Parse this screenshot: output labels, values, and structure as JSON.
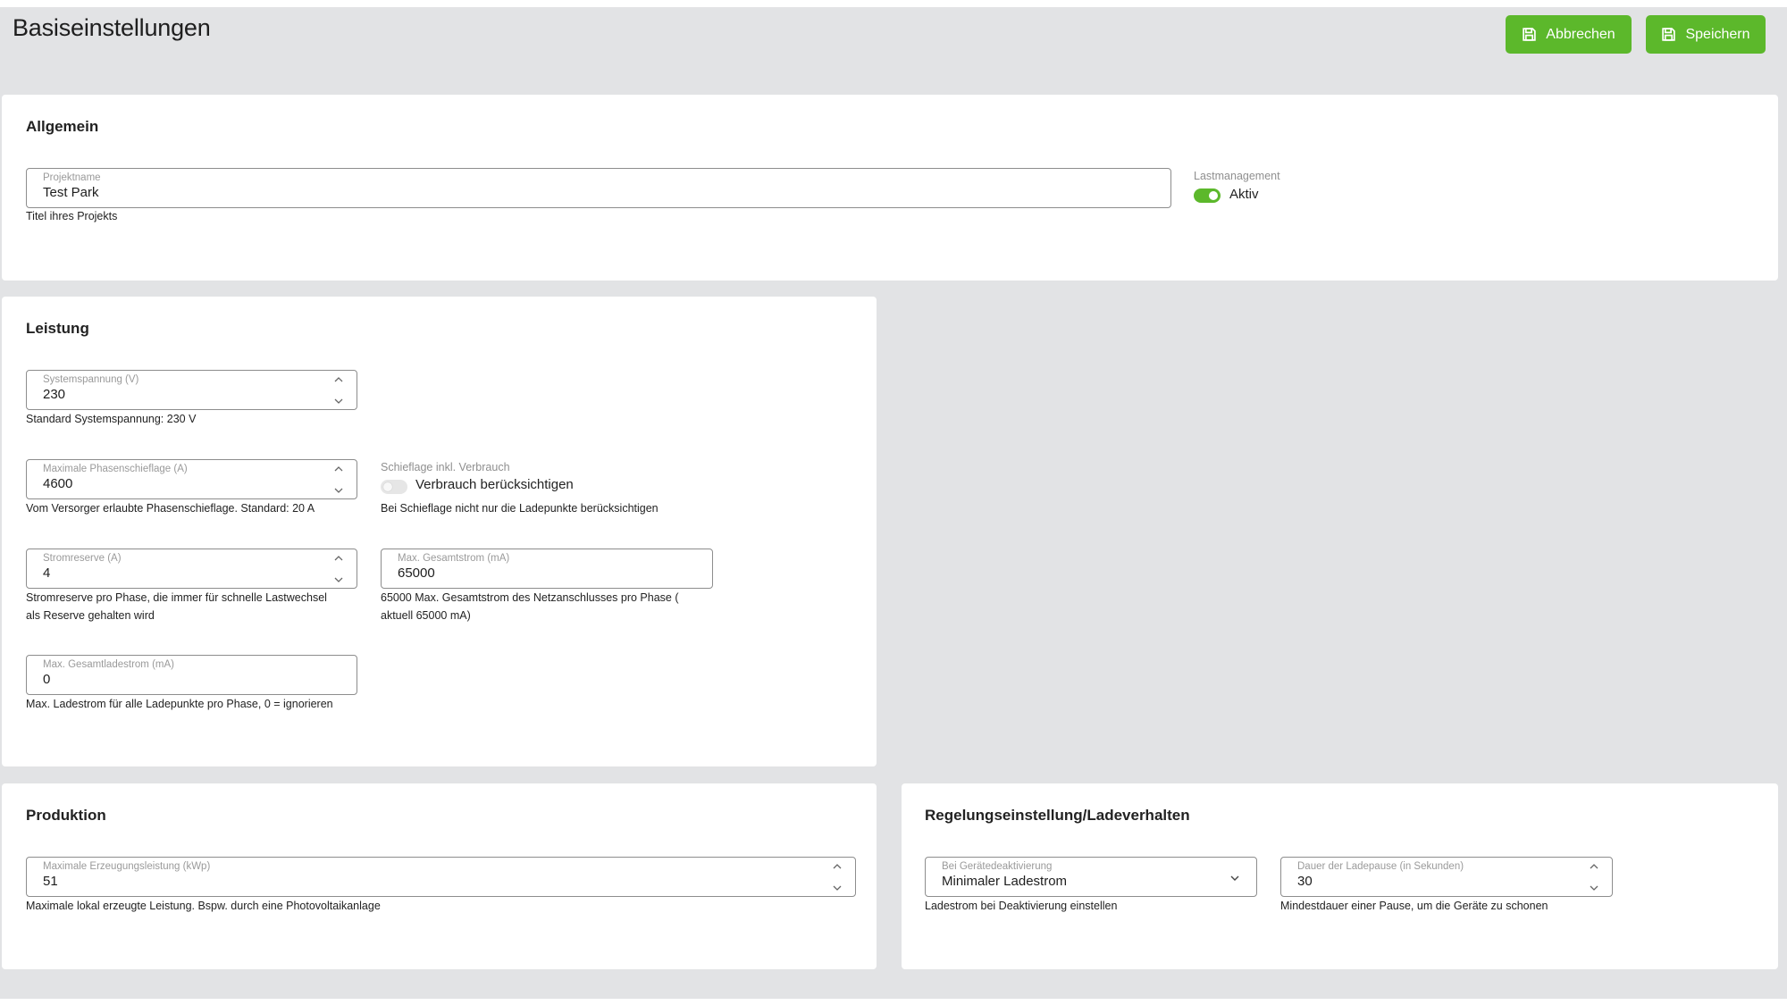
{
  "header": {
    "title": "Basiseinstellungen",
    "cancel_label": "Abbrechen",
    "save_label": "Speichern",
    "accent_color": "#5cb82b"
  },
  "allgemein": {
    "title": "Allgemein",
    "project_name": {
      "label": "Projektname",
      "value": "Test Park",
      "helper": "Titel ihres Projekts"
    },
    "lastmanagement": {
      "label": "Lastmanagement",
      "toggle_text": "Aktiv",
      "enabled": true
    }
  },
  "leistung": {
    "title": "Leistung",
    "systemspannung": {
      "label": "Systemspannung (V)",
      "value": "230",
      "helper": "Standard Systemspannung: 230 V"
    },
    "phasenschieflage": {
      "label": "Maximale Phasenschieflage (A)",
      "value": "4600",
      "helper": "Vom Versorger erlaubte Phasenschieflage. Standard: 20 A"
    },
    "schieflage": {
      "label": "Schieflage inkl. Verbrauch",
      "toggle_text": "Verbrauch berücksichtigen",
      "enabled": false,
      "helper": "Bei Schieflage nicht nur die Ladepunkte berücksichtigen"
    },
    "stromreserve": {
      "label": "Stromreserve (A)",
      "value": "4",
      "helper_line1": "Stromreserve pro Phase, die immer für schnelle Lastwechsel",
      "helper_line2": "als Reserve gehalten wird"
    },
    "gesamtstrom": {
      "label": "Max. Gesamtstrom (mA)",
      "value": "65000",
      "helper_line1": "65000 Max. Gesamtstrom des Netzanschlusses pro Phase (",
      "helper_line2": "aktuell 65000 mA)"
    },
    "gesamtladestrom": {
      "label": "Max. Gesamtladestrom (mA)",
      "value": "0",
      "helper": "Max. Ladestrom für alle Ladepunkte pro Phase, 0 = ignorieren"
    }
  },
  "produktion": {
    "title": "Produktion",
    "erzeugungsleistung": {
      "label": "Maximale Erzeugungsleistung (kWp)",
      "value": "51",
      "helper": "Maximale lokal erzeugte Leistung. Bspw. durch eine Photovoltaikanlage"
    }
  },
  "regelung": {
    "title": "Regelungseinstellung/Ladeverhalten",
    "deaktivierung": {
      "label": "Bei Gerätedeaktivierung",
      "value": "Minimaler Ladestrom",
      "helper": "Ladestrom bei Deaktivierung einstellen"
    },
    "ladepause": {
      "label": "Dauer der Ladepause (in Sekunden)",
      "value": "30",
      "helper": "Mindestdauer einer Pause, um die Geräte zu schonen"
    }
  }
}
